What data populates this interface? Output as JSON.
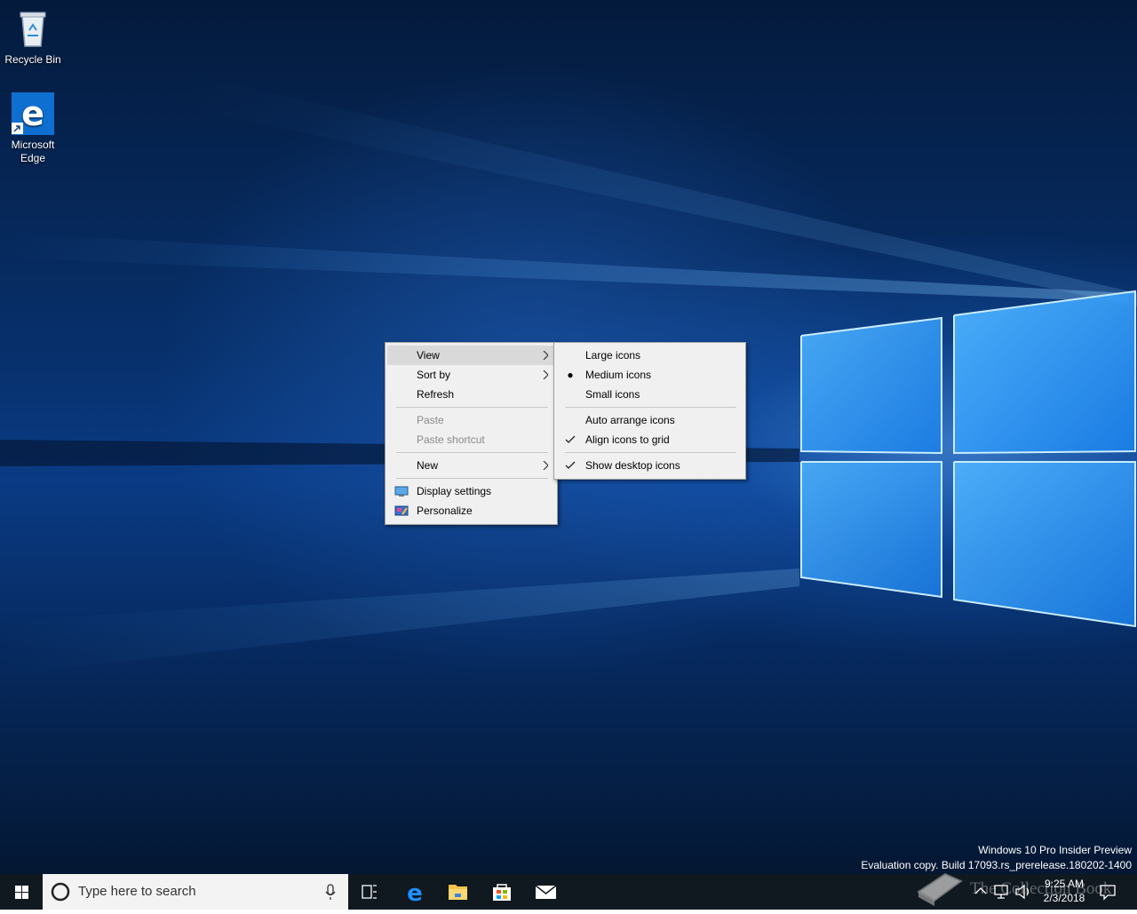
{
  "desktop": {
    "icons": [
      {
        "label": "Recycle Bin",
        "icon": "recycle-bin-icon"
      },
      {
        "label": "Microsoft Edge",
        "icon": "edge-icon"
      }
    ]
  },
  "context_menu": {
    "items": [
      {
        "label": "View",
        "submenu": true,
        "highlighted": true
      },
      {
        "label": "Sort by",
        "submenu": true
      },
      {
        "label": "Refresh"
      },
      {
        "label": "Paste",
        "disabled": true
      },
      {
        "label": "Paste shortcut",
        "disabled": true
      },
      {
        "label": "New",
        "submenu": true
      },
      {
        "label": "Display settings",
        "icon": "display-settings-icon"
      },
      {
        "label": "Personalize",
        "icon": "personalize-icon"
      }
    ]
  },
  "view_submenu": {
    "items": [
      {
        "label": "Large icons"
      },
      {
        "label": "Medium icons",
        "mark": "bullet"
      },
      {
        "label": "Small icons"
      },
      {
        "label": "Auto arrange icons"
      },
      {
        "label": "Align icons to grid",
        "mark": "check"
      },
      {
        "label": "Show desktop icons",
        "mark": "check"
      }
    ]
  },
  "watermark": {
    "line1": "Windows 10 Pro Insider Preview",
    "line2": "Evaluation copy. Build 17093.rs_prerelease.180202-1400"
  },
  "taskbar": {
    "search_placeholder": "Type here to search",
    "clock_time": "9:25 AM",
    "clock_date": "2/3/2018",
    "pinned": [
      "task-view-icon",
      "edge-icon",
      "file-explorer-icon",
      "store-icon",
      "mail-icon"
    ]
  },
  "overlay_logo": {
    "text": "The Collection Book"
  },
  "colors": {
    "menu_bg": "#f0f0f0",
    "menu_highlight": "#d9d9d9",
    "taskbar_bg": "#101820",
    "edge_blue": "#0f6fd1"
  }
}
